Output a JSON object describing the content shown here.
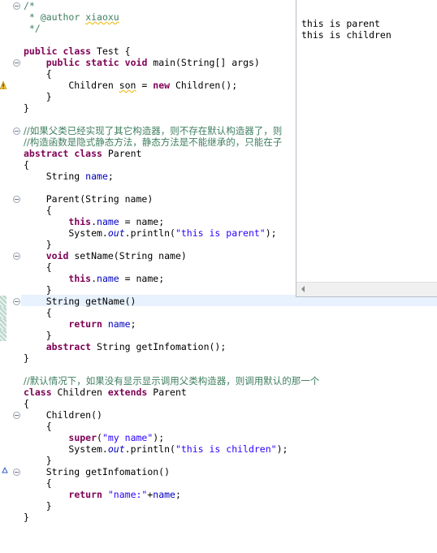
{
  "editor": {
    "lines": [
      [
        {
          "t": "/*",
          "c": "cmt"
        }
      ],
      [
        {
          "t": " * ",
          "c": "cmt"
        },
        {
          "t": "@author",
          "c": "cmt"
        },
        {
          "t": " ",
          "c": "cmt"
        },
        {
          "t": "xiaoxu",
          "c": "cmt squig"
        }
      ],
      [
        {
          "t": " */",
          "c": "cmt"
        }
      ],
      [],
      [
        {
          "t": "public",
          "c": "kw"
        },
        {
          "t": " "
        },
        {
          "t": "class",
          "c": "kw"
        },
        {
          "t": " Test {"
        }
      ],
      [
        {
          "t": "    "
        },
        {
          "t": "public",
          "c": "kw"
        },
        {
          "t": " "
        },
        {
          "t": "static",
          "c": "kw"
        },
        {
          "t": " "
        },
        {
          "t": "void",
          "c": "kw"
        },
        {
          "t": " main(String[] args)"
        }
      ],
      [
        {
          "t": "    {"
        }
      ],
      [
        {
          "t": "        Children "
        },
        {
          "t": "son",
          "c": "squig"
        },
        {
          "t": " = "
        },
        {
          "t": "new",
          "c": "kw"
        },
        {
          "t": " Children();"
        }
      ],
      [
        {
          "t": "    }"
        }
      ],
      [
        {
          "t": "}"
        }
      ],
      [],
      [
        {
          "t": "//如果父类已经实现了其它构造器，则不存在默认构造器了，则",
          "c": "cmt cj"
        }
      ],
      [
        {
          "t": "//构造函数是隐式静态方法，静态方法是不能继承的，只能在子",
          "c": "cmt cj"
        }
      ],
      [
        {
          "t": "abstract",
          "c": "kw"
        },
        {
          "t": " "
        },
        {
          "t": "class",
          "c": "kw"
        },
        {
          "t": " Parent"
        }
      ],
      [
        {
          "t": "{"
        }
      ],
      [
        {
          "t": "    String "
        },
        {
          "t": "name",
          "c": "fld"
        },
        {
          "t": ";"
        }
      ],
      [],
      [
        {
          "t": "    Parent(String name)"
        }
      ],
      [
        {
          "t": "    {"
        }
      ],
      [
        {
          "t": "        "
        },
        {
          "t": "this",
          "c": "kw"
        },
        {
          "t": "."
        },
        {
          "t": "name",
          "c": "fld"
        },
        {
          "t": " = name;"
        }
      ],
      [
        {
          "t": "        System."
        },
        {
          "t": "out",
          "c": "sfld"
        },
        {
          "t": ".println("
        },
        {
          "t": "\"this is parent\"",
          "c": "str"
        },
        {
          "t": ");"
        }
      ],
      [
        {
          "t": "    }"
        }
      ],
      [
        {
          "t": "    "
        },
        {
          "t": "void",
          "c": "kw"
        },
        {
          "t": " setName(String name)"
        }
      ],
      [
        {
          "t": "    {"
        }
      ],
      [
        {
          "t": "        "
        },
        {
          "t": "this",
          "c": "kw"
        },
        {
          "t": "."
        },
        {
          "t": "name",
          "c": "fld"
        },
        {
          "t": " = name;"
        }
      ],
      [
        {
          "t": "    }"
        }
      ],
      [
        {
          "t": "    String getName()"
        }
      ],
      [
        {
          "t": "    {"
        }
      ],
      [
        {
          "t": "        "
        },
        {
          "t": "return",
          "c": "kw"
        },
        {
          "t": " "
        },
        {
          "t": "name",
          "c": "fld"
        },
        {
          "t": ";"
        }
      ],
      [
        {
          "t": "    }"
        }
      ],
      [
        {
          "t": "    "
        },
        {
          "t": "abstract",
          "c": "kw"
        },
        {
          "t": " String getInfomation();"
        }
      ],
      [
        {
          "t": "}"
        }
      ],
      [],
      [
        {
          "t": "//默认情况下，如果没有显示显示调用父类构造器，则调用默认的那一个",
          "c": "cmt cj"
        }
      ],
      [
        {
          "t": "class",
          "c": "kw"
        },
        {
          "t": " Children "
        },
        {
          "t": "extends",
          "c": "kw"
        },
        {
          "t": " Parent"
        }
      ],
      [
        {
          "t": "{"
        }
      ],
      [
        {
          "t": "    Children()"
        }
      ],
      [
        {
          "t": "    {"
        }
      ],
      [
        {
          "t": "        "
        },
        {
          "t": "super",
          "c": "kw"
        },
        {
          "t": "("
        },
        {
          "t": "\"my name\"",
          "c": "str"
        },
        {
          "t": ");"
        }
      ],
      [
        {
          "t": "        System."
        },
        {
          "t": "out",
          "c": "sfld"
        },
        {
          "t": ".println("
        },
        {
          "t": "\"this is children\"",
          "c": "str"
        },
        {
          "t": ");"
        }
      ],
      [
        {
          "t": "    }"
        }
      ],
      [
        {
          "t": "    String getInfomation()"
        }
      ],
      [
        {
          "t": "    {"
        }
      ],
      [
        {
          "t": "        "
        },
        {
          "t": "return",
          "c": "kw"
        },
        {
          "t": " "
        },
        {
          "t": "\"name:\"",
          "c": "str"
        },
        {
          "t": "+"
        },
        {
          "t": "name",
          "c": "fld"
        },
        {
          "t": ";"
        }
      ],
      [
        {
          "t": "    }"
        }
      ],
      [
        {
          "t": "}"
        }
      ]
    ]
  },
  "console": {
    "output": [
      "this is parent",
      "this is children"
    ]
  },
  "colors": {
    "comment": "#3f7f5f",
    "keyword": "#7f0055",
    "string": "#2a00ff",
    "field": "#0000c0"
  }
}
